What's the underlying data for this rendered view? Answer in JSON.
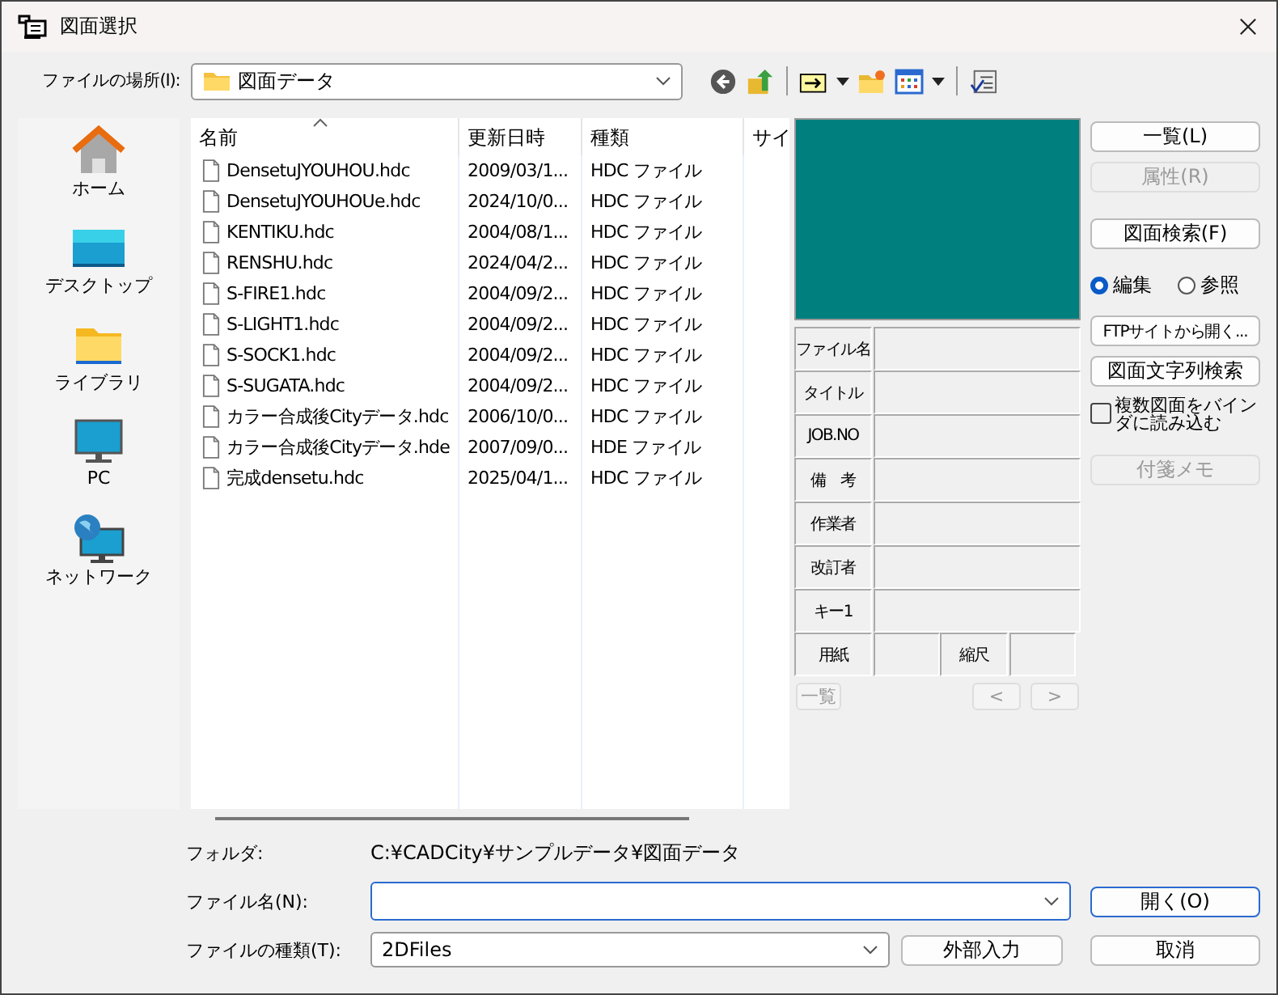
{
  "window": {
    "title": "図面選択"
  },
  "location": {
    "label": "ファイルの場所(I):",
    "value": "図面データ"
  },
  "places": [
    {
      "kind": "home",
      "label": "ホーム"
    },
    {
      "kind": "desktop",
      "label": "デスクトップ"
    },
    {
      "kind": "library",
      "label": "ライブラリ"
    },
    {
      "kind": "pc",
      "label": "PC"
    },
    {
      "kind": "network",
      "label": "ネットワーク"
    }
  ],
  "file_list": {
    "columns": [
      {
        "label": "名前",
        "sorted": true
      },
      {
        "label": "更新日時",
        "sorted": false
      },
      {
        "label": "種類",
        "sorted": false
      },
      {
        "label": "サイ",
        "sorted": false
      }
    ],
    "rows": [
      {
        "name": "DensetuJYOUHOU.hdc",
        "modified": "2009/03/1...",
        "type": "HDC ファイル",
        "selected": false
      },
      {
        "name": "DensetuJYOUHOUe.hdc",
        "modified": "2024/10/0...",
        "type": "HDC ファイル",
        "selected": false
      },
      {
        "name": "KENTIKU.hdc",
        "modified": "2004/08/1...",
        "type": "HDC ファイル",
        "selected": false
      },
      {
        "name": "RENSHU.hdc",
        "modified": "2024/04/2...",
        "type": "HDC ファイル",
        "selected": false
      },
      {
        "name": "S-FIRE1.hdc",
        "modified": "2004/09/2...",
        "type": "HDC ファイル",
        "selected": false
      },
      {
        "name": "S-LIGHT1.hdc",
        "modified": "2004/09/2...",
        "type": "HDC ファイル",
        "selected": false
      },
      {
        "name": "S-SOCK1.hdc",
        "modified": "2004/09/2...",
        "type": "HDC ファイル",
        "selected": false
      },
      {
        "name": "S-SUGATA.hdc",
        "modified": "2004/09/2...",
        "type": "HDC ファイル",
        "selected": false
      },
      {
        "name": "カラー合成後Cityデータ.hdc",
        "modified": "2006/10/0...",
        "type": "HDC ファイル",
        "selected": false
      },
      {
        "name": "カラー合成後Cityデータ.hde",
        "modified": "2007/09/0...",
        "type": "HDE ファイル",
        "selected": false
      },
      {
        "name": "完成densetu.hdc",
        "modified": "2025/04/1...",
        "type": "HDC ファイル",
        "selected": false
      }
    ]
  },
  "preview": {
    "fields": [
      "ファイル名",
      "タイトル",
      "JOB.NO",
      "備　考",
      "作業者",
      "改訂者",
      "キー1"
    ],
    "paper_label": "用紙",
    "scale_label": "縮尺",
    "list_button": {
      "label": "一覧",
      "disabled": true
    },
    "prev_button": {
      "label": "<",
      "disabled": true
    },
    "next_button": {
      "label": ">",
      "disabled": true
    }
  },
  "side_controls": [
    {
      "kind": "button",
      "label": "一覧(L)",
      "disabled": false
    },
    {
      "kind": "button",
      "label": "属性(R)",
      "disabled": true
    },
    {
      "kind": "button",
      "label": "図面検索(F)",
      "disabled": false
    },
    {
      "kind": "radios",
      "options": [
        {
          "label": "編集",
          "selected": true
        },
        {
          "label": "参照",
          "selected": false
        }
      ]
    },
    {
      "kind": "button",
      "label": "FTPサイトから開く...",
      "disabled": false
    },
    {
      "kind": "button",
      "label": "図面文字列検索",
      "disabled": false
    },
    {
      "kind": "checkbox",
      "label": "複数図面をバインダに読み込む",
      "checked": false
    },
    {
      "kind": "button",
      "label": "付箋メモ",
      "disabled": true
    }
  ],
  "folder": {
    "label": "フォルダ:",
    "value": "C:¥CADCity¥サンプルデータ¥図面データ"
  },
  "file_name": {
    "label": "ファイル名(N):"
  },
  "file_type": {
    "label": "ファイルの種類(T):",
    "value": "2DFiles"
  },
  "buttons": {
    "import": "外部入力",
    "open": "開く(O)",
    "cancel": "取消"
  }
}
